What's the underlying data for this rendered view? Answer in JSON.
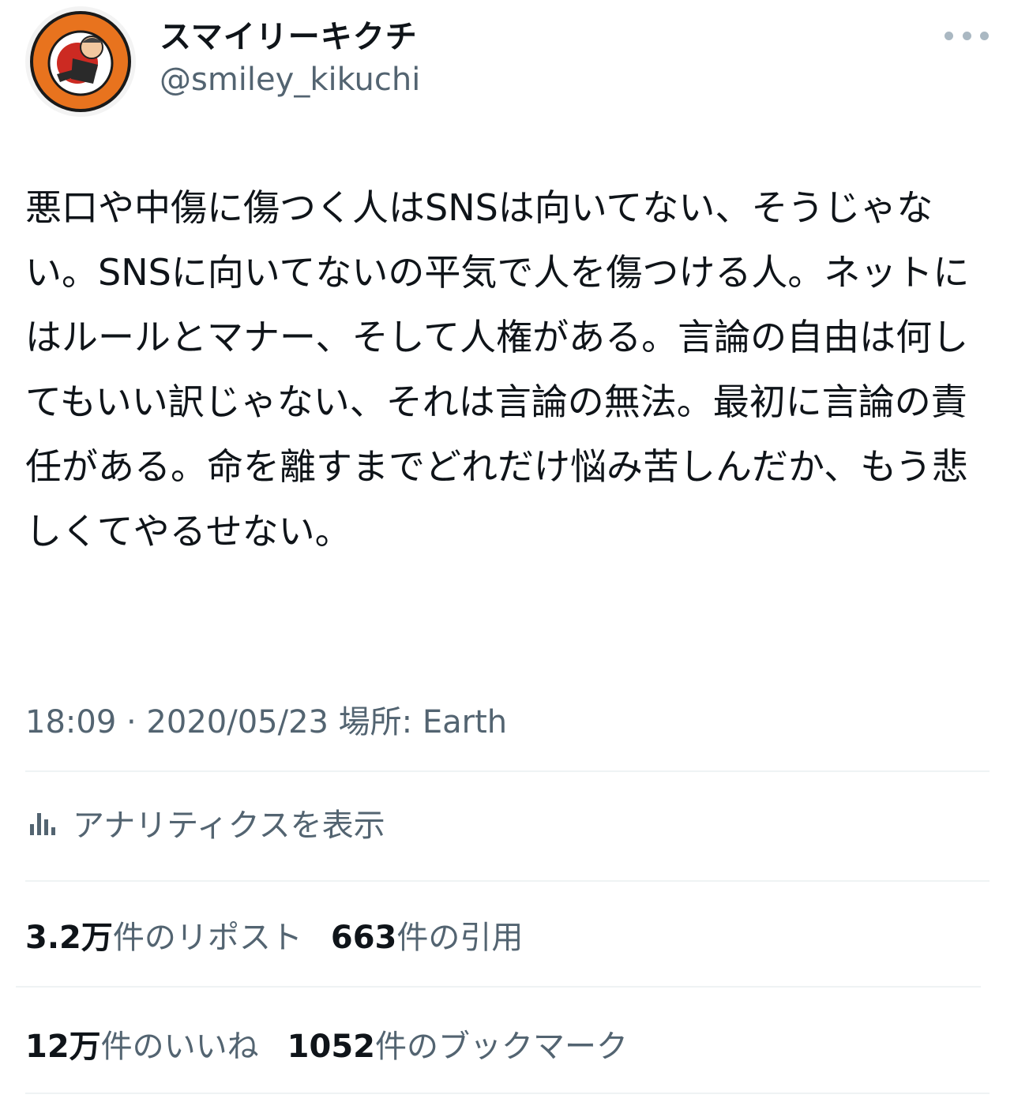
{
  "user": {
    "display_name": "スマイリーキクチ",
    "handle": "@smiley_kikuchi",
    "avatar_text": "スマイリーキクチ"
  },
  "tweet": {
    "text": "悪口や中傷に傷つく人はSNSは向いてない、そうじゃない。SNSに向いてないの平気で人を傷つける人。ネットにはルールとマナー、そして人権がある。言論の自由は何してもいい訳じゃない、それは言論の無法。最初に言論の責任がある。命を離すまでどれだけ悩み苦しんだか、もう悲しくてやるせない。",
    "meta": "18:09 · 2020/05/23 場所: Earth"
  },
  "analytics": {
    "label": "アナリティクスを表示",
    "icon": "bar-chart-icon"
  },
  "stats": {
    "reposts_count": "3.2万",
    "reposts_label": "件のリポスト",
    "quotes_count": "663",
    "quotes_label": "件の引用",
    "likes_count": "12万",
    "likes_label": "件のいいね",
    "bookmarks_count": "1052",
    "bookmarks_label": "件のブックマーク"
  },
  "colors": {
    "text": "#0f1419",
    "secondary": "#536471",
    "divider": "#eff3f4",
    "avatar_orange": "#e8731e"
  }
}
